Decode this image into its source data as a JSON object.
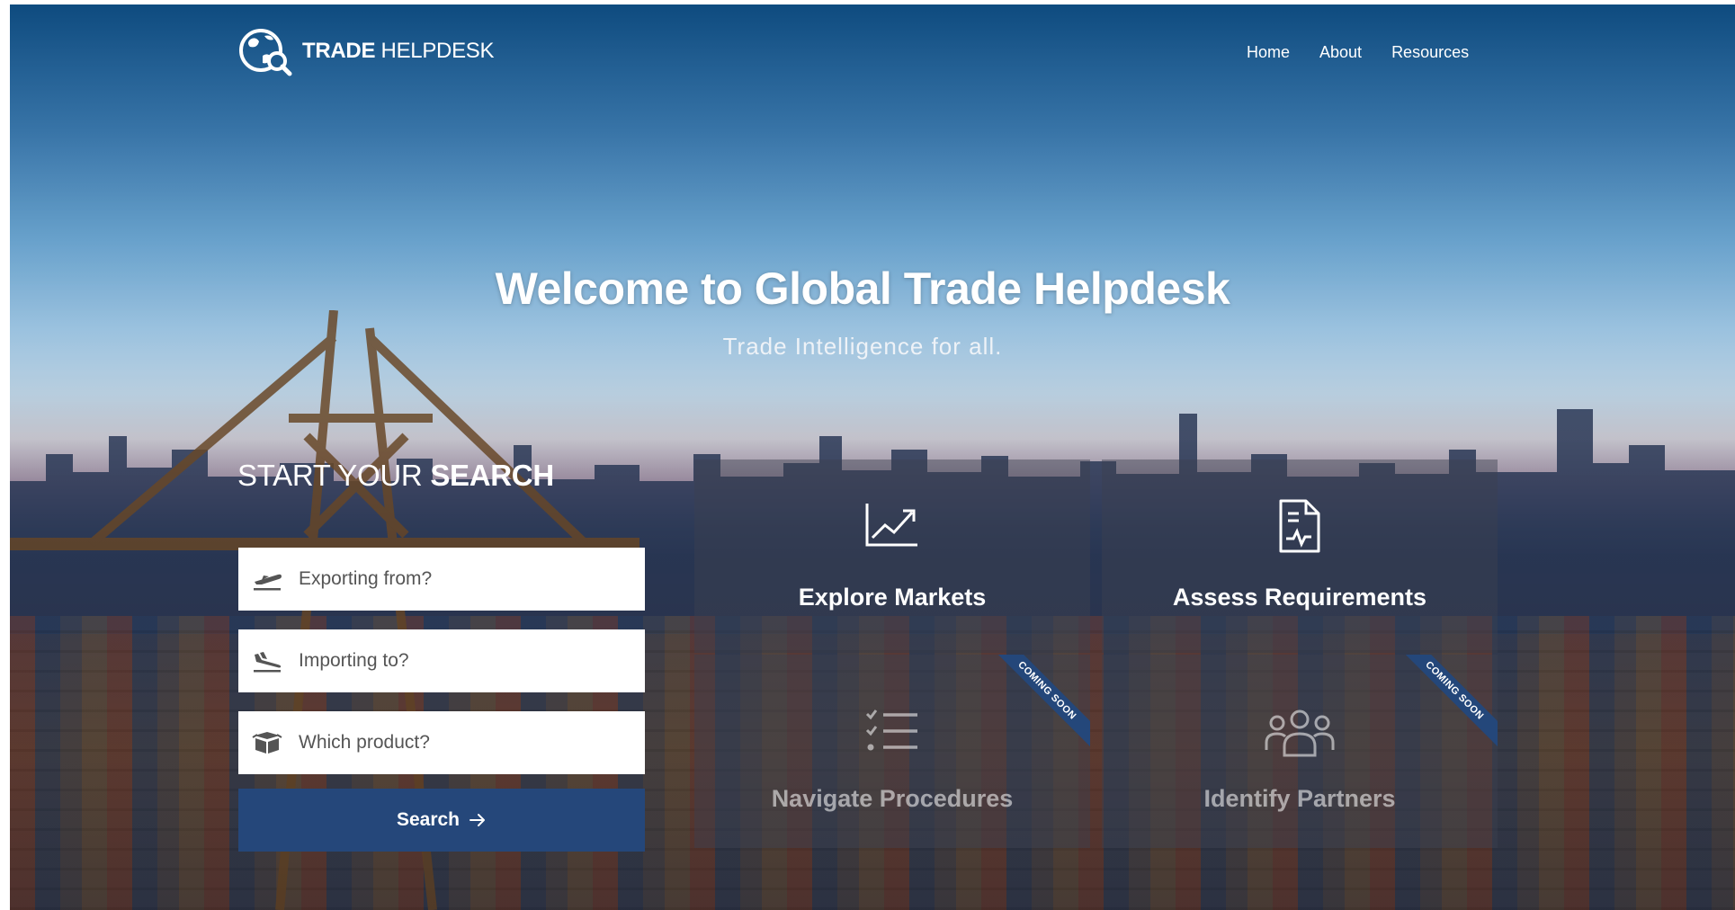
{
  "brand": {
    "bold": "TRADE",
    "light": "HELPDESK"
  },
  "nav": {
    "home": "Home",
    "about": "About",
    "resources": "Resources"
  },
  "hero": {
    "title": "Welcome to Global Trade Helpdesk",
    "subtitle": "Trade Intelligence for all."
  },
  "search": {
    "heading_light": "START YOUR ",
    "heading_bold": "SEARCH",
    "exporting_placeholder": "Exporting from?",
    "importing_placeholder": "Importing to?",
    "product_placeholder": "Which product?",
    "button_label": "Search"
  },
  "tiles": [
    {
      "label": "Explore Markets",
      "icon": "trend-chart-icon",
      "status": ""
    },
    {
      "label": "Assess Requirements",
      "icon": "document-icon",
      "status": ""
    },
    {
      "label": "Navigate Procedures",
      "icon": "checklist-icon",
      "status": "COMING SOON"
    },
    {
      "label": "Identify Partners",
      "icon": "people-group-icon",
      "status": "COMING SOON"
    }
  ],
  "colors": {
    "primary_button": "#25477a",
    "ribbon": "#24477a",
    "text": "#ffffff"
  }
}
